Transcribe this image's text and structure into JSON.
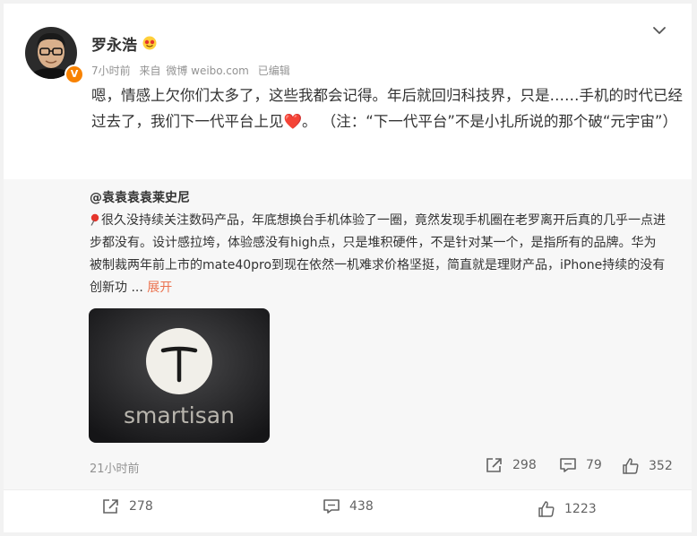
{
  "post": {
    "author": "罗永浩",
    "time": "7小时前",
    "source_prefix": "来自",
    "source": "微博 weibo.com",
    "edited": "已编辑",
    "text_main": "嗯，情感上欠你们太多了，这些我都会记得。年后就回归科技界，只是……手机的时代已经过去了，我们下一代平台上见",
    "text_heart": "❤️",
    "text_tail": "。 （注：“下一代平台”不是小扎所说的那个破“元宇宙”）"
  },
  "retweet": {
    "author": "@袁袁袁袁莱史尼",
    "text": "很久没持续关注数码产品，年底想换台手机体验了一圈，竟然发现手机圈在老罗离开后真的几乎一点进步都没有。设计感拉垮，体验感没有high点，只是堆积硬件，不是针对某一个，是指所有的品牌。华为被制裁两年前上市的mate40pro到现在依然一机难求价格坚挺，简直就是理财产品，iPhone持续的没有创新功 ...",
    "expand": "展开",
    "image_text": "smartisan",
    "time": "21小时前",
    "reposts": "298",
    "comments": "79",
    "likes": "352"
  },
  "actions": {
    "reposts": "278",
    "comments": "438",
    "likes": "1223"
  },
  "colors": {
    "background": "#f2f2f2",
    "card": "#ffffff",
    "retweet_bg": "#f7f7f7",
    "accent_link": "#eb7350",
    "verified_badge": "#f88200"
  }
}
